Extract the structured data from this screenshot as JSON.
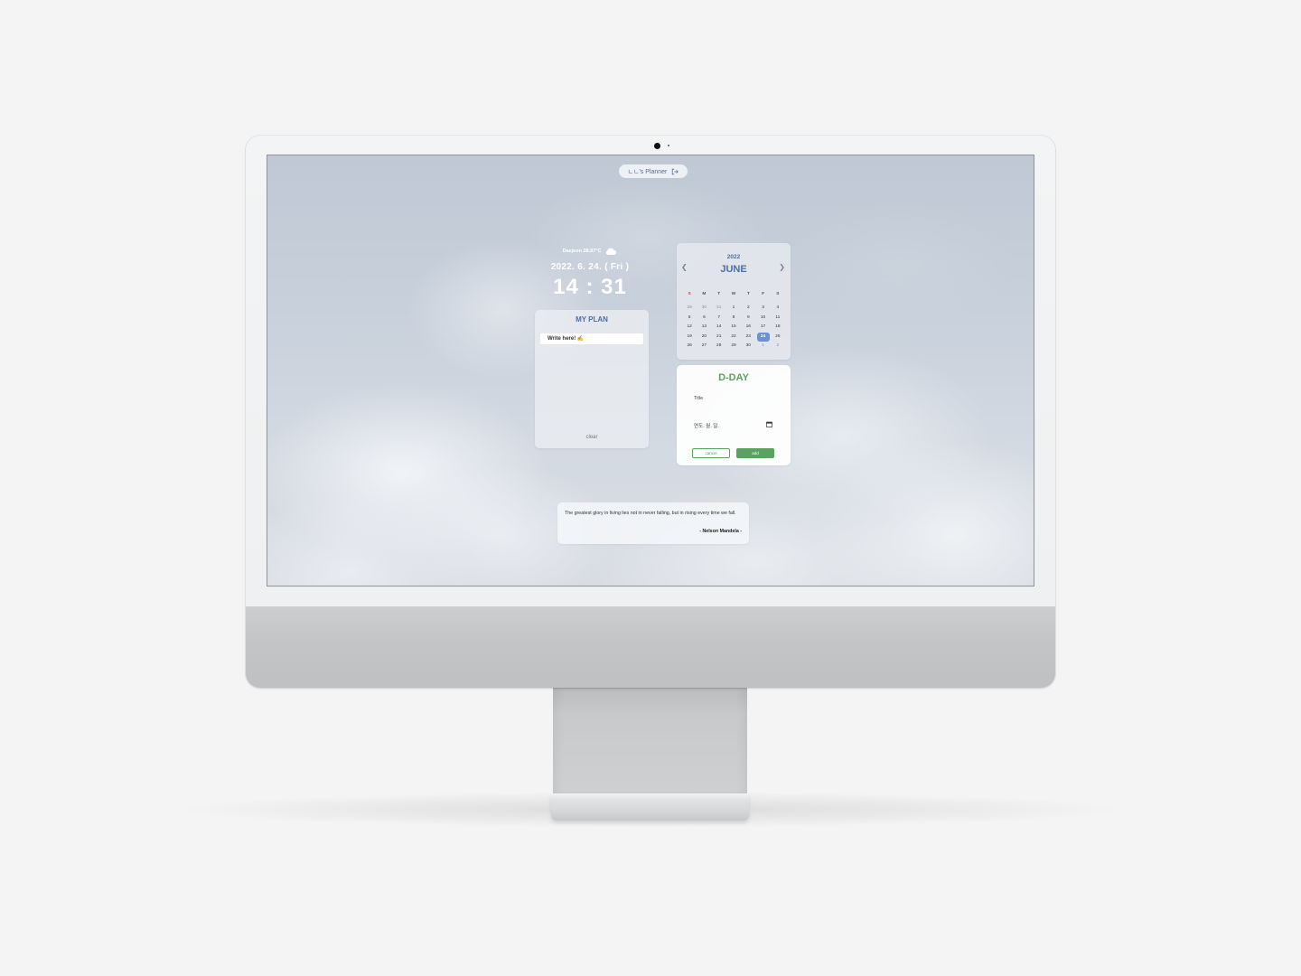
{
  "app": {
    "title": "ㄴㄴ's Planner",
    "icons": {
      "logout": "logout-icon"
    }
  },
  "weather": {
    "text": "Daejeon 28.97°C",
    "icon": "cloud-icon"
  },
  "date": {
    "text": "2022. 6. 24. ( Fri )"
  },
  "clock": {
    "time": "14 : 31"
  },
  "plan": {
    "title": "MY PLAN",
    "input_placeholder": "Write here! ✍",
    "clear_label": "clear"
  },
  "calendar": {
    "year": "2022",
    "month": "JUNE",
    "prev_icon": "chevron-left-icon",
    "next_icon": "chevron-right-icon",
    "weekdays": [
      "S",
      "M",
      "T",
      "W",
      "T",
      "F",
      "S"
    ],
    "weeks": [
      [
        "29",
        "30",
        "31",
        "1",
        "2",
        "3",
        "4"
      ],
      [
        "5",
        "6",
        "7",
        "8",
        "9",
        "10",
        "11"
      ],
      [
        "12",
        "13",
        "14",
        "15",
        "16",
        "17",
        "18"
      ],
      [
        "19",
        "20",
        "21",
        "22",
        "23",
        "24",
        "25"
      ],
      [
        "26",
        "27",
        "28",
        "29",
        "30",
        "1",
        "2"
      ]
    ],
    "today": "24",
    "accent_color": "#6d8fd6"
  },
  "dday": {
    "title": "D-DAY",
    "title_placeholder": "Title",
    "date_placeholder": "연도. 월. 일.",
    "date_icon": "calendar-icon",
    "cancel_label": "cancel",
    "add_label": "add",
    "accent_color": "#5aa35e"
  },
  "quote": {
    "text": "The greatest glory in living lies not in never falling, but in rising every time we fall.",
    "author": "- Nelson Mandela -"
  }
}
